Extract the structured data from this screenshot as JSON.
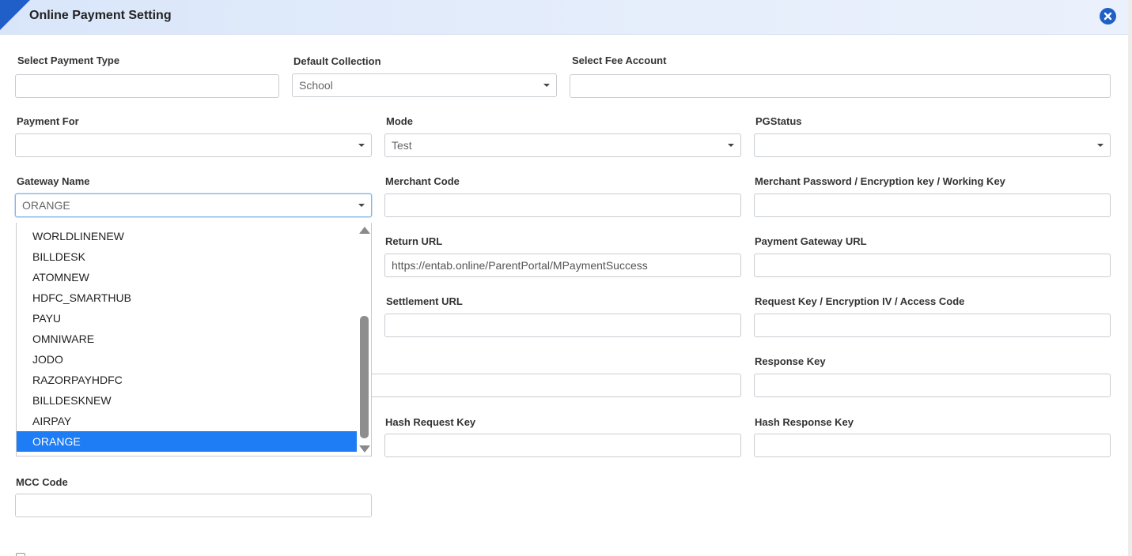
{
  "dialog": {
    "title": "Online Payment Setting"
  },
  "fields": {
    "select_payment_type": {
      "label": "Select Payment Type",
      "value": ""
    },
    "default_collection": {
      "label": "Default Collection",
      "value": "School"
    },
    "select_fee_account": {
      "label": "Select Fee Account",
      "value": ""
    },
    "payment_for": {
      "label": "Payment For",
      "value": ""
    },
    "mode": {
      "label": "Mode",
      "value": "Test"
    },
    "pg_status": {
      "label": "PGStatus",
      "value": ""
    },
    "gateway_name": {
      "label": "Gateway Name",
      "value": "ORANGE"
    },
    "merchant_code": {
      "label": "Merchant Code",
      "value": ""
    },
    "merchant_password": {
      "label": "Merchant Password / Encryption key / Working Key",
      "value": ""
    },
    "return_url": {
      "label": "Return URL",
      "value": "https://entab.online/ParentPortal/MPaymentSuccess"
    },
    "payment_gateway_url": {
      "label": "Payment Gateway URL",
      "value": ""
    },
    "settlement_url": {
      "label": "Settlement URL",
      "value": ""
    },
    "request_key": {
      "label": "Request Key / Encryption IV / Access Code",
      "value": ""
    },
    "hidden_field": {
      "value": ""
    },
    "response_key": {
      "label": "Response Key",
      "value": ""
    },
    "hash_request_key": {
      "label": "Hash Request Key",
      "value": ""
    },
    "hash_response_key": {
      "label": "Hash Response Key",
      "value": ""
    },
    "mcc_code": {
      "label": "MCC Code",
      "value": ""
    }
  },
  "gateway_dropdown": {
    "options": [
      "WORLDLINENEW",
      "BILLDESK",
      "ATOMNEW",
      "HDFC_SMARTHUB",
      "PAYU",
      "OMNIWARE",
      "JODO",
      "RAZORPAYHDFC",
      "BILLDESKNEW",
      "AIRPAY",
      "ORANGE"
    ],
    "selected": "ORANGE"
  },
  "colors": {
    "accent": "#1f5fc7",
    "selected_option_bg": "#1e7cf5",
    "header_bg": "#dfe9fb"
  }
}
